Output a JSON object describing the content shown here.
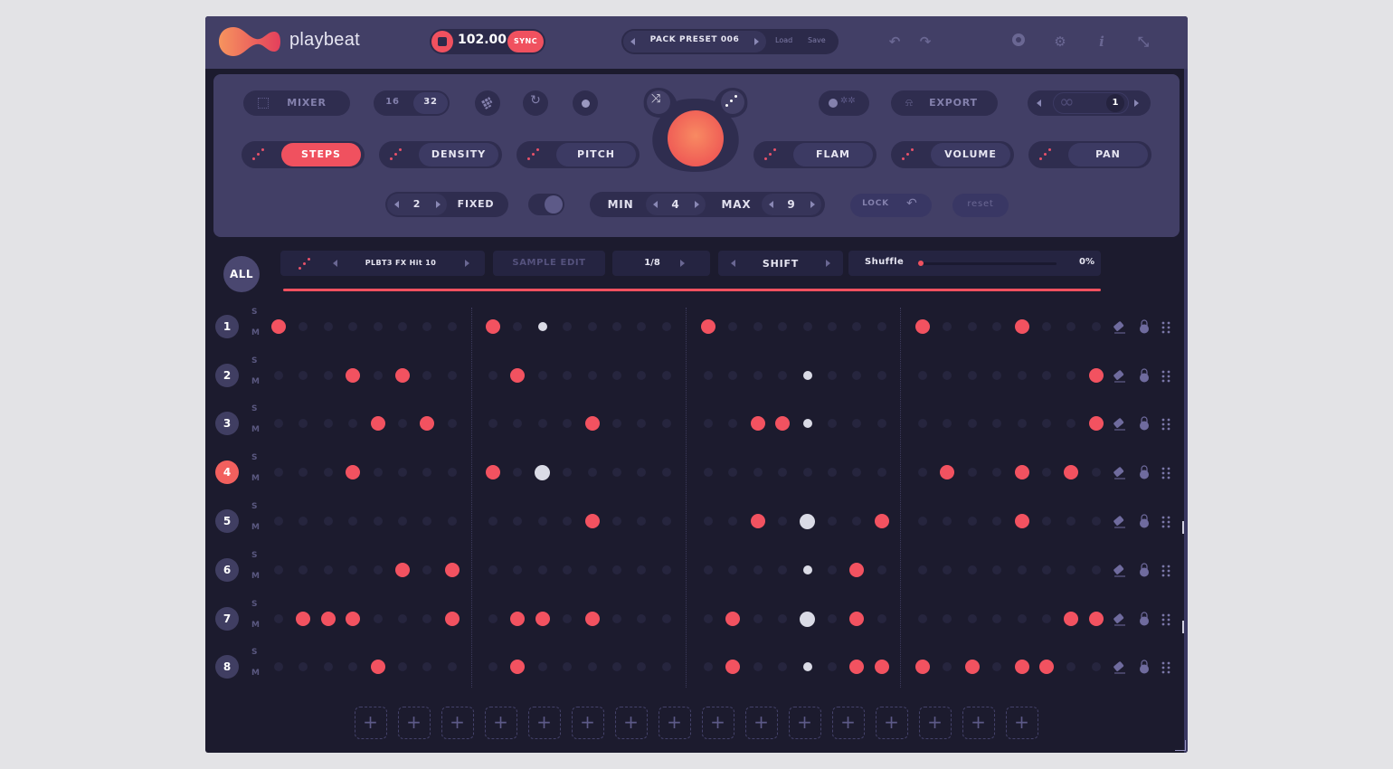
{
  "app": {
    "brand": "playbeat",
    "accent_color": "#f0515f",
    "panel_color": "#423f66",
    "grid_bg": "#1c1b2e"
  },
  "transport": {
    "stop_icon": "stop-icon",
    "bpm": "102.00",
    "sync_label": "SYNC"
  },
  "preset": {
    "name": "PACK PRESET 006",
    "load_label": "Load",
    "save_label": "Save"
  },
  "topbar_icons": [
    "undo-icon",
    "redo-icon",
    "midi-icon",
    "settings-icon",
    "info-icon",
    "collapse-icon"
  ],
  "controls": {
    "mixer_label": "MIXER",
    "steps_options": [
      "16",
      "32"
    ],
    "steps_selected": "32",
    "export_label": "EXPORT",
    "loop_count": "1",
    "modifiers": [
      {
        "label": "STEPS",
        "active": true
      },
      {
        "label": "DENSITY",
        "active": false
      },
      {
        "label": "PITCH",
        "active": false
      },
      {
        "label": "FLAM",
        "active": false
      },
      {
        "label": "VOLUME",
        "active": false
      },
      {
        "label": "PAN",
        "active": false
      }
    ],
    "fixed_value": "2",
    "fixed_label": "FIXED",
    "min_label": "MIN",
    "min_value": "4",
    "max_label": "MAX",
    "max_value": "9",
    "lock_label": "LOCK",
    "reset_label": "reset"
  },
  "toolbar": {
    "all_label": "ALL",
    "sample_name": "PLBT3 FX Hit 10",
    "sample_edit_label": "SAMPLE EDIT",
    "rate": "1/8",
    "shift_label": "SHIFT",
    "shuffle_label": "Shuffle",
    "shuffle_value": "0%",
    "shuffle_fraction": 0
  },
  "sm_labels": {
    "solo": "S",
    "mute": "M"
  },
  "rows": [
    {
      "num": "1",
      "active": false,
      "steps": "R.......R.w.....R.......R...R..."
    },
    {
      "num": "2",
      "active": false,
      "steps": "...R.R...R..........w..........R"
    },
    {
      "num": "3",
      "active": false,
      "steps": "....R.R.....R.....RRw..........R"
    },
    {
      "num": "4",
      "active": true,
      "steps": "...R....R.W..............R..R.R."
    },
    {
      "num": "5",
      "active": false,
      "steps": "............R.....R.W..R....R..."
    },
    {
      "num": "6",
      "active": false,
      "steps": ".....R.R............w.R........"
    },
    {
      "num": "7",
      "active": false,
      "steps": ".RRR...R.RR.R....R..W.R.......RR"
    },
    {
      "num": "8",
      "active": false,
      "steps": "....R....R.......R..w.RRR.R.RR.."
    }
  ],
  "slot_count": 16,
  "slot_label": "+"
}
